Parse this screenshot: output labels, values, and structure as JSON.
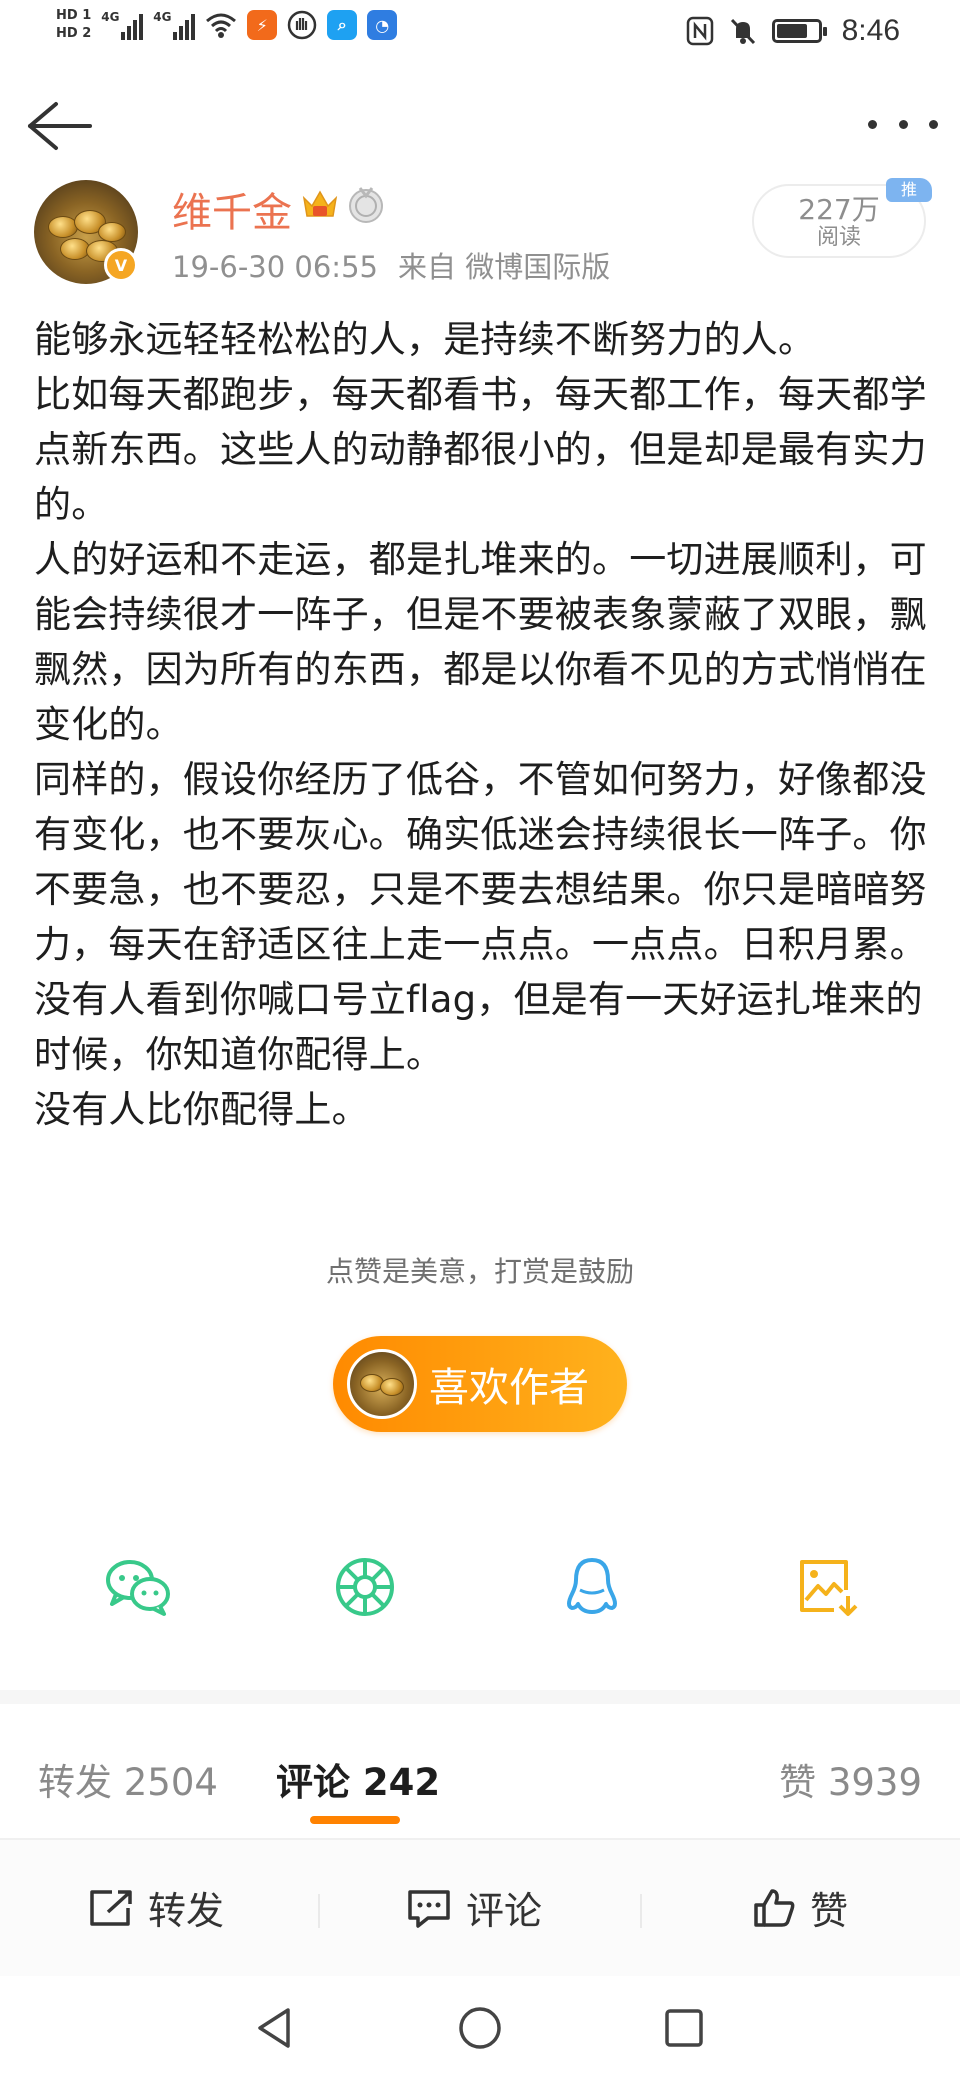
{
  "status_bar": {
    "hd1": "HD 1",
    "hd2": "HD 2",
    "net1": "4G",
    "net2": "4G",
    "time": "8:46",
    "icons": [
      "wifi-icon",
      "app-notification-icon",
      "hand-icon",
      "search-app-icon",
      "browser-app-icon",
      "nfc-icon",
      "mute-icon",
      "battery-icon"
    ]
  },
  "nav": {
    "back_icon": "back-arrow-icon",
    "more_icon": "more-icon"
  },
  "author": {
    "name": "维千金",
    "date": "19-6-30 06:55",
    "source": "来自 微博国际版",
    "reads_count": "227万",
    "reads_label": "阅读",
    "push_badge": "推"
  },
  "post": {
    "paragraphs": [
      "能够永远轻轻松松的人，是持续不断努力的人。",
      "比如每天都跑步，每天都看书，每天都工作，每天都学点新东西。这些人的动静都很小的，但是却是最有实力的。",
      "人的好运和不走运，都是扎堆来的。一切进展顺利，可能会持续很才一阵子，但是不要被表象蒙蔽了双眼，飘飘然，因为所有的东西，都是以你看不见的方式悄悄在变化的。",
      "同样的，假设你经历了低谷，不管如何努力，好像都没有变化，也不要灰心。确实低迷会持续很长一阵子。你不要急，也不要忍，只是不要去想结果。你只是暗暗努力，每天在舒适区往上走一点点。一点点。日积月累。",
      "没有人看到你喊口号立flag，但是有一天好运扎堆来的时候，你知道你配得上。",
      "没有人比你配得上。"
    ]
  },
  "reward": {
    "tip": "点赞是美意，打赏是鼓励",
    "button_label": "喜欢作者"
  },
  "share": {
    "icons": [
      "wechat-icon",
      "moments-icon",
      "qq-icon",
      "save-image-icon"
    ]
  },
  "tabs": {
    "repost": "转发 2504",
    "comment": "评论 242",
    "like": "赞 3939"
  },
  "actions": {
    "repost": "转发",
    "comment": "评论",
    "like": "赞"
  },
  "colors": {
    "accent": "#ff8200",
    "author_name": "#eb7350",
    "share_green": "#38c98a",
    "qq_blue": "#3aa6e8",
    "save_yellow": "#f5b21b"
  }
}
